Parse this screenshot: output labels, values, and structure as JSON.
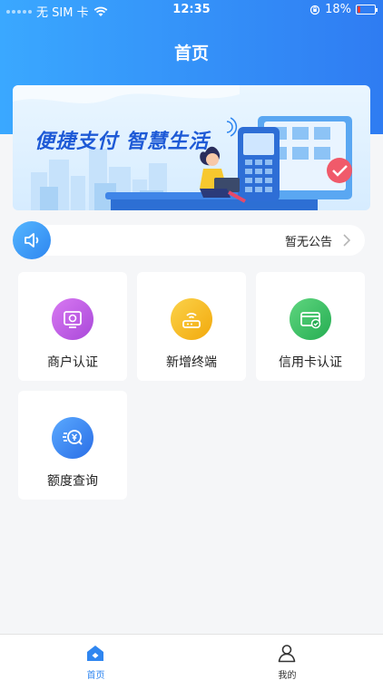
{
  "status_bar": {
    "carrier": "无 SIM 卡",
    "time": "12:35",
    "battery": "18%",
    "battery_level": 0.18
  },
  "header": {
    "title": "首页"
  },
  "banner": {
    "slogan": "便捷支付 智慧生活"
  },
  "notice": {
    "text": "暂无公告"
  },
  "tiles": [
    {
      "label": "商户认证",
      "icon": "merchant-certification-icon",
      "color": "#c25fe8"
    },
    {
      "label": "新增终端",
      "icon": "add-terminal-icon",
      "color": "#f7b715"
    },
    {
      "label": "信用卡认证",
      "icon": "credit-card-certification-icon",
      "color": "#36c063"
    },
    {
      "label": "额度查询",
      "icon": "quota-query-icon",
      "color": "#2f86f0"
    }
  ],
  "tab_bar": {
    "items": [
      {
        "label": "首页",
        "icon": "home-icon",
        "active": true
      },
      {
        "label": "我的",
        "icon": "profile-icon",
        "active": false
      }
    ]
  },
  "colors": {
    "primary": "#2f86f0",
    "header_start": "#3aa8ff",
    "header_end": "#2f7cf2",
    "background": "#f5f6f8"
  }
}
